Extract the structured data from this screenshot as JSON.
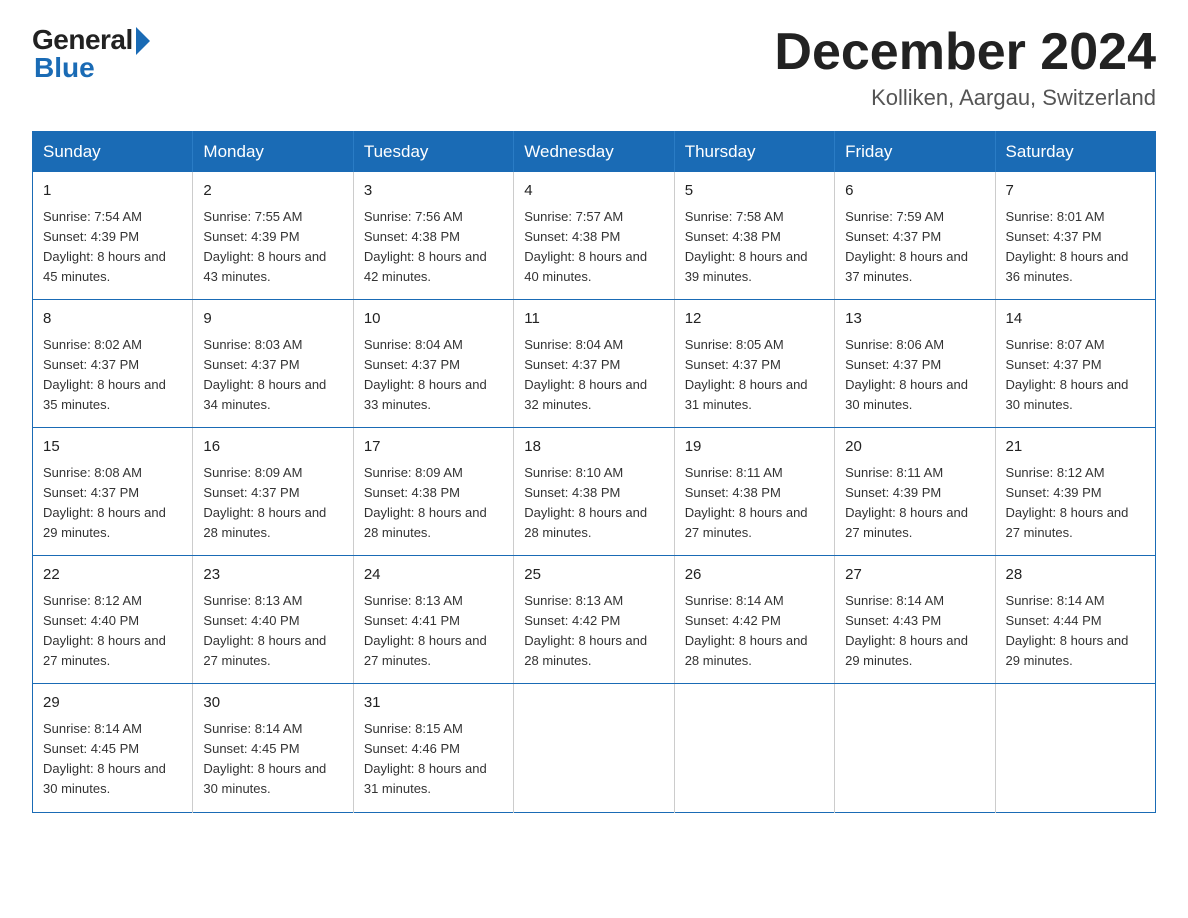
{
  "header": {
    "logo_general": "General",
    "logo_blue": "Blue",
    "month_title": "December 2024",
    "location": "Kolliken, Aargau, Switzerland"
  },
  "days_of_week": [
    "Sunday",
    "Monday",
    "Tuesday",
    "Wednesday",
    "Thursday",
    "Friday",
    "Saturday"
  ],
  "weeks": [
    [
      {
        "day": "1",
        "sunrise": "7:54 AM",
        "sunset": "4:39 PM",
        "daylight": "8 hours and 45 minutes."
      },
      {
        "day": "2",
        "sunrise": "7:55 AM",
        "sunset": "4:39 PM",
        "daylight": "8 hours and 43 minutes."
      },
      {
        "day": "3",
        "sunrise": "7:56 AM",
        "sunset": "4:38 PM",
        "daylight": "8 hours and 42 minutes."
      },
      {
        "day": "4",
        "sunrise": "7:57 AM",
        "sunset": "4:38 PM",
        "daylight": "8 hours and 40 minutes."
      },
      {
        "day": "5",
        "sunrise": "7:58 AM",
        "sunset": "4:38 PM",
        "daylight": "8 hours and 39 minutes."
      },
      {
        "day": "6",
        "sunrise": "7:59 AM",
        "sunset": "4:37 PM",
        "daylight": "8 hours and 37 minutes."
      },
      {
        "day": "7",
        "sunrise": "8:01 AM",
        "sunset": "4:37 PM",
        "daylight": "8 hours and 36 minutes."
      }
    ],
    [
      {
        "day": "8",
        "sunrise": "8:02 AM",
        "sunset": "4:37 PM",
        "daylight": "8 hours and 35 minutes."
      },
      {
        "day": "9",
        "sunrise": "8:03 AM",
        "sunset": "4:37 PM",
        "daylight": "8 hours and 34 minutes."
      },
      {
        "day": "10",
        "sunrise": "8:04 AM",
        "sunset": "4:37 PM",
        "daylight": "8 hours and 33 minutes."
      },
      {
        "day": "11",
        "sunrise": "8:04 AM",
        "sunset": "4:37 PM",
        "daylight": "8 hours and 32 minutes."
      },
      {
        "day": "12",
        "sunrise": "8:05 AM",
        "sunset": "4:37 PM",
        "daylight": "8 hours and 31 minutes."
      },
      {
        "day": "13",
        "sunrise": "8:06 AM",
        "sunset": "4:37 PM",
        "daylight": "8 hours and 30 minutes."
      },
      {
        "day": "14",
        "sunrise": "8:07 AM",
        "sunset": "4:37 PM",
        "daylight": "8 hours and 30 minutes."
      }
    ],
    [
      {
        "day": "15",
        "sunrise": "8:08 AM",
        "sunset": "4:37 PM",
        "daylight": "8 hours and 29 minutes."
      },
      {
        "day": "16",
        "sunrise": "8:09 AM",
        "sunset": "4:37 PM",
        "daylight": "8 hours and 28 minutes."
      },
      {
        "day": "17",
        "sunrise": "8:09 AM",
        "sunset": "4:38 PM",
        "daylight": "8 hours and 28 minutes."
      },
      {
        "day": "18",
        "sunrise": "8:10 AM",
        "sunset": "4:38 PM",
        "daylight": "8 hours and 28 minutes."
      },
      {
        "day": "19",
        "sunrise": "8:11 AM",
        "sunset": "4:38 PM",
        "daylight": "8 hours and 27 minutes."
      },
      {
        "day": "20",
        "sunrise": "8:11 AM",
        "sunset": "4:39 PM",
        "daylight": "8 hours and 27 minutes."
      },
      {
        "day": "21",
        "sunrise": "8:12 AM",
        "sunset": "4:39 PM",
        "daylight": "8 hours and 27 minutes."
      }
    ],
    [
      {
        "day": "22",
        "sunrise": "8:12 AM",
        "sunset": "4:40 PM",
        "daylight": "8 hours and 27 minutes."
      },
      {
        "day": "23",
        "sunrise": "8:13 AM",
        "sunset": "4:40 PM",
        "daylight": "8 hours and 27 minutes."
      },
      {
        "day": "24",
        "sunrise": "8:13 AM",
        "sunset": "4:41 PM",
        "daylight": "8 hours and 27 minutes."
      },
      {
        "day": "25",
        "sunrise": "8:13 AM",
        "sunset": "4:42 PM",
        "daylight": "8 hours and 28 minutes."
      },
      {
        "day": "26",
        "sunrise": "8:14 AM",
        "sunset": "4:42 PM",
        "daylight": "8 hours and 28 minutes."
      },
      {
        "day": "27",
        "sunrise": "8:14 AM",
        "sunset": "4:43 PM",
        "daylight": "8 hours and 29 minutes."
      },
      {
        "day": "28",
        "sunrise": "8:14 AM",
        "sunset": "4:44 PM",
        "daylight": "8 hours and 29 minutes."
      }
    ],
    [
      {
        "day": "29",
        "sunrise": "8:14 AM",
        "sunset": "4:45 PM",
        "daylight": "8 hours and 30 minutes."
      },
      {
        "day": "30",
        "sunrise": "8:14 AM",
        "sunset": "4:45 PM",
        "daylight": "8 hours and 30 minutes."
      },
      {
        "day": "31",
        "sunrise": "8:15 AM",
        "sunset": "4:46 PM",
        "daylight": "8 hours and 31 minutes."
      },
      null,
      null,
      null,
      null
    ]
  ]
}
